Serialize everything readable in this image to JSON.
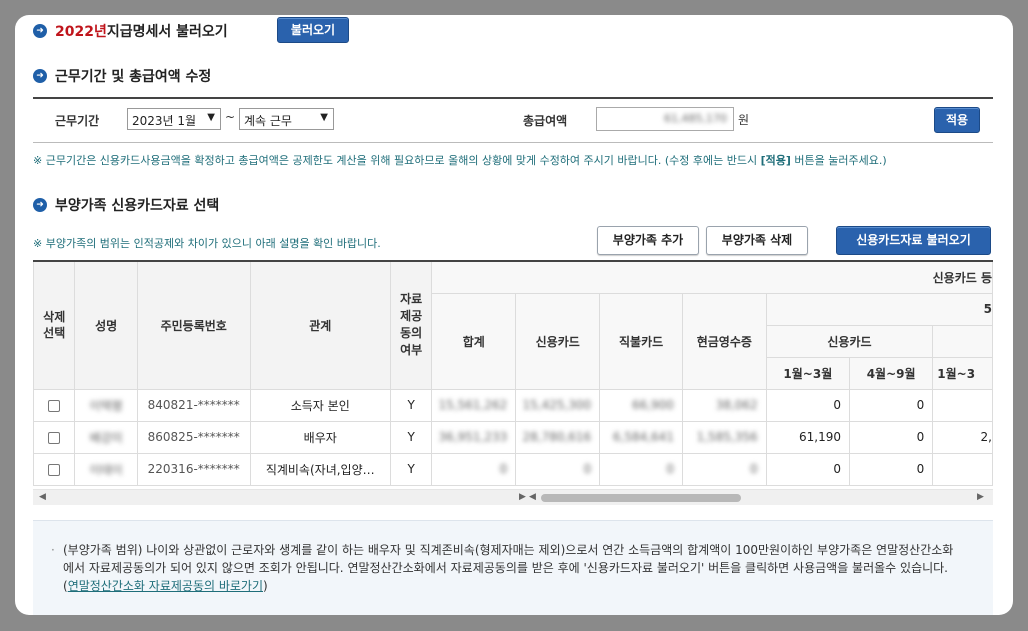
{
  "header": {
    "year": "2022년",
    "title": " 지급명세서 불러오기",
    "load_button": "불러오기"
  },
  "period_section": {
    "title": "근무기간 및 총급여액 수정",
    "period_label": "근무기간",
    "start_select": "2023년 1월",
    "tilde": "~",
    "end_select": "계속 근무",
    "salary_label": "총급여액",
    "salary_value": "61,485,170",
    "unit": "원",
    "apply_button": "적용",
    "note_prefix": "※ 근무기간은 신용카드사용금액을 확정하고 총급여액은 공제한도 계산을 위해 필요하므로 올해의 상황에 맞게 수정하여 주시기 바랍니다. (수정 후에는 반드시 ",
    "note_bold": "[적용]",
    "note_suffix": " 버튼을 눌러주세요.)"
  },
  "dependent_section": {
    "title": "부양가족 신용카드자료 선택",
    "note": "※ 부양가족의 범위는 인적공제와 차이가 있으니 아래 설명을 확인 바랍니다.",
    "add_button": "부양가족 추가",
    "delete_button": "부양가족 삭제",
    "load_card_button": "신용카드자료 불러오기"
  },
  "table": {
    "headers": {
      "delete_select": "삭제\n선택",
      "name": "성명",
      "resident_no": "주민등록번호",
      "relation": "관계",
      "consent": "자료\n제공\n동의\n여부",
      "card_group": "신용카드 등",
      "total": "합계",
      "credit_card": "신용카드",
      "debit_card": "직불카드",
      "cash_receipt": "현금영수증",
      "five": "5",
      "sub_credit": "신용카드",
      "m1_3": "1월~3월",
      "m4_9": "4월~9월",
      "m1_3b": "1월~3"
    },
    "rows": [
      {
        "name": "이택평",
        "resident_no": "840821-*******",
        "relation": "소득자 본인",
        "consent": "Y",
        "total": "15,561,262",
        "credit": "15,425,300",
        "debit": "66,900",
        "cash": "38,062",
        "m1_3": "0",
        "m4_9": "0",
        "m1_3b": ""
      },
      {
        "name": "배강미",
        "resident_no": "860825-*******",
        "relation": "배우자",
        "consent": "Y",
        "total": "36,951,233",
        "credit": "28,780,616",
        "debit": "6,584,641",
        "cash": "1,585,356",
        "m1_3": "61,190",
        "m4_9": "0",
        "m1_3b": "2,"
      },
      {
        "name": "이태이",
        "resident_no": "220316-*******",
        "relation": "직계비속(자녀,입양…",
        "consent": "Y",
        "total": "0",
        "credit": "0",
        "debit": "0",
        "cash": "0",
        "m1_3": "0",
        "m4_9": "0",
        "m1_3b": ""
      }
    ]
  },
  "info": {
    "bullet": "·",
    "text": "(부양가족 범위) 나이와 상관없이 근로자와 생계를 같이 하는 배우자 및 직계존비속(형제자매는 제외)으로서 연간 소득금액의 합계액이 100만원이하인 부양가족은 연말정산간소화에서 자료제공동의가 되어 있지 않으면 조회가 안됩니다. 연말정산간소화에서 자료제공동의를 받은 후에 '신용카드자료 불러오기' 버튼을 클릭하면 사용금액을 불러올수 있습니다. (",
    "link": "연말정산간소화 자료제공동의 바로가기",
    "text_end": ")"
  }
}
